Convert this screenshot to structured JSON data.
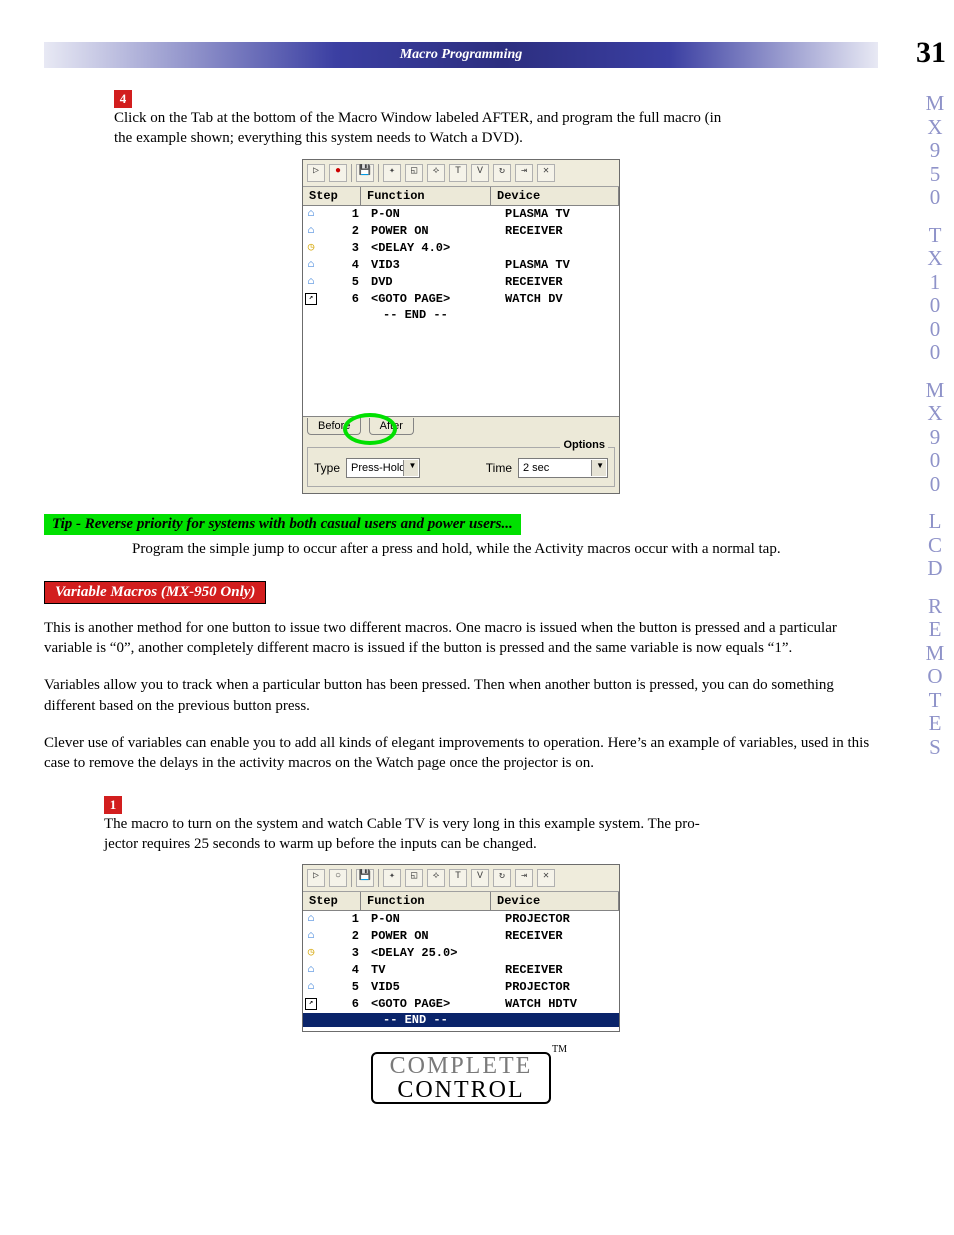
{
  "header": {
    "title": "Macro Programming"
  },
  "page_number": "31",
  "side_label": "MX950 TX1000 MX900 LCD REMOTES",
  "step4": {
    "num": "4",
    "text_a": "Click on the Tab at the bottom of the Macro Window labeled AFTER, and program the full macro (in",
    "text_b": "the example shown; everything this system needs to Watch a DVD)."
  },
  "macro1": {
    "cols": {
      "step": "Step",
      "func": "Function",
      "dev": "Device"
    },
    "rows": [
      {
        "icon": "ir",
        "n": "1",
        "func": "P-ON",
        "dev": "PLASMA TV"
      },
      {
        "icon": "ir",
        "n": "2",
        "func": "POWER ON",
        "dev": "RECEIVER"
      },
      {
        "icon": "delay",
        "n": "3",
        "func": "<DELAY 4.0>",
        "dev": ""
      },
      {
        "icon": "ir",
        "n": "4",
        "func": "VID3",
        "dev": "PLASMA TV"
      },
      {
        "icon": "ir",
        "n": "5",
        "func": "DVD",
        "dev": "RECEIVER"
      },
      {
        "icon": "jump",
        "n": "6",
        "func": "<GOTO PAGE>",
        "dev": "WATCH DV"
      }
    ],
    "end": "-- END --",
    "tabs": {
      "before": "Before",
      "after": "After"
    },
    "options": {
      "legend": "Options",
      "type_label": "Type",
      "type_value": "Press-Hold",
      "time_label": "Time",
      "time_value": "2 sec"
    }
  },
  "tip": {
    "title": "Tip - Reverse priority for systems with both casual users and power users...",
    "body": "Program the simple jump to occur after a press and hold, while the Activity macros occur with a normal tap."
  },
  "section": {
    "title": "Variable Macros (MX-950 Only)"
  },
  "para1": "This is another method for one button to issue two different macros. One macro is issued when the button is pressed and a particular variable is “0”, another completely different macro is issued if the button is pressed and the same variable is now equals “1”.",
  "para2": "Variables allow you to track when a particular button has been pressed. Then when another button is pressed, you can do something different based on the previous button press.",
  "para3": "Clever use of variables can enable you to add all kinds of elegant improvements to operation. Here’s an example of variables, used in this case to remove the delays in the activity macros on the Watch page once the projector is on.",
  "step1b": {
    "num": "1",
    "text_a": "The macro to turn on the system and watch Cable TV is very long in this example system. The pro-",
    "text_b": "jector requires 25 seconds to warm up before the inputs can be changed."
  },
  "macro2": {
    "cols": {
      "step": "Step",
      "func": "Function",
      "dev": "Device"
    },
    "rows": [
      {
        "icon": "ir",
        "n": "1",
        "func": "P-ON",
        "dev": "PROJECTOR"
      },
      {
        "icon": "ir",
        "n": "2",
        "func": "POWER ON",
        "dev": "RECEIVER"
      },
      {
        "icon": "delay",
        "n": "3",
        "func": "<DELAY 25.0>",
        "dev": ""
      },
      {
        "icon": "ir",
        "n": "4",
        "func": "TV",
        "dev": "RECEIVER"
      },
      {
        "icon": "ir",
        "n": "5",
        "func": "VID5",
        "dev": "PROJECTOR"
      },
      {
        "icon": "jump",
        "n": "6",
        "func": "<GOTO PAGE>",
        "dev": "WATCH HDTV"
      }
    ],
    "end": "-- END --"
  },
  "footer": {
    "l1": "COMPLETE",
    "l2": "CONTROL",
    "tm": "TM"
  }
}
